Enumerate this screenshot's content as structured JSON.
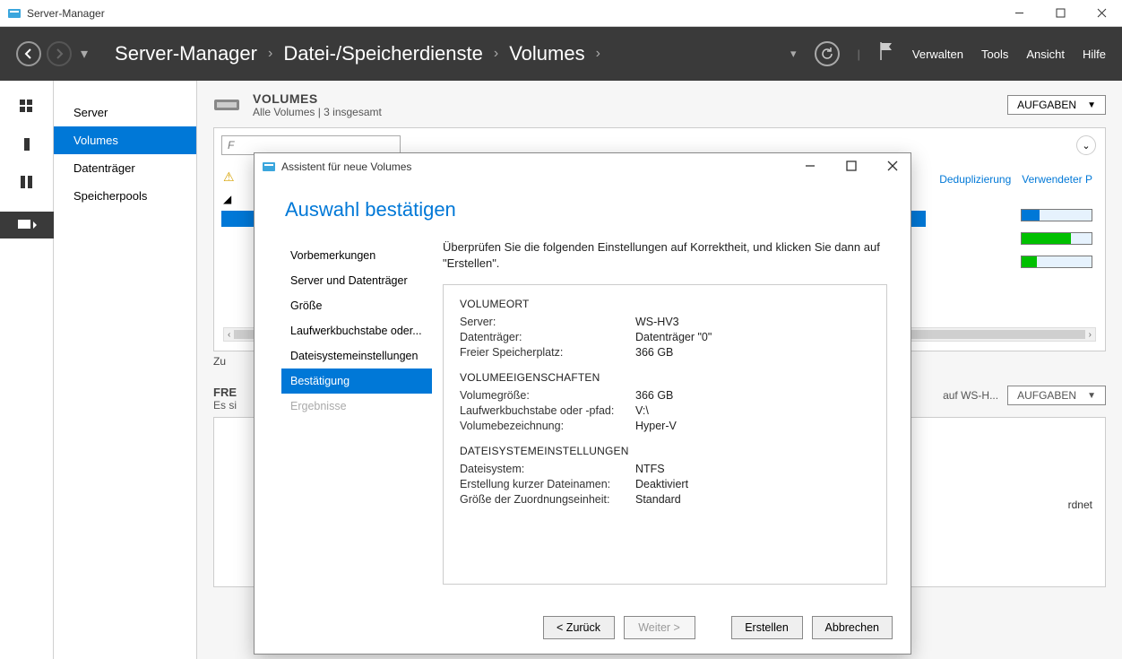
{
  "app": {
    "name": "Server-Manager"
  },
  "header": {
    "breadcrumb": [
      "Server-Manager",
      "Datei-/Speicherdienste",
      "Volumes"
    ],
    "menu": {
      "verwalten": "Verwalten",
      "tools": "Tools",
      "ansicht": "Ansicht",
      "hilfe": "Hilfe"
    }
  },
  "sidebar": {
    "items": [
      {
        "label": "Server"
      },
      {
        "label": "Volumes"
      },
      {
        "label": "Datenträger"
      },
      {
        "label": "Speicherpools"
      }
    ],
    "active_index": 1
  },
  "volumes_section": {
    "title": "VOLUMES",
    "subtitle": "Alle Volumes | 3 insgesamt",
    "aufgaben": "AUFGABEN",
    "filter_placeholder": "F",
    "col_links": [
      "Deduplizierung",
      "Verwendeter P"
    ],
    "footer_text": "Zu"
  },
  "freigaben_section": {
    "title_prefix": "FRE",
    "subtitle_prefix": "Es si",
    "right_frag": "auf WS-H...",
    "aufgaben": "AUFGABEN",
    "panel_text": "rdnet"
  },
  "wizard": {
    "title": "Assistent für neue Volumes",
    "heading": "Auswahl bestätigen",
    "steps": [
      "Vorbemerkungen",
      "Server und Datenträger",
      "Größe",
      "Laufwerkbuchstabe oder...",
      "Dateisystemeinstellungen",
      "Bestätigung",
      "Ergebnisse"
    ],
    "active_step_index": 5,
    "disabled_step_index": 6,
    "instruction": "Überprüfen Sie die folgenden Einstellungen auf Korrektheit, und klicken Sie dann auf \"Erstellen\".",
    "sections": [
      {
        "title": "VOLUMEORT",
        "rows": [
          {
            "label": "Server:",
            "value": "WS-HV3"
          },
          {
            "label": "Datenträger:",
            "value": "Datenträger \"0\""
          },
          {
            "label": "Freier Speicherplatz:",
            "value": "366 GB"
          }
        ]
      },
      {
        "title": "VOLUMEEIGENSCHAFTEN",
        "rows": [
          {
            "label": "Volumegröße:",
            "value": "366 GB"
          },
          {
            "label": "Laufwerkbuchstabe oder -pfad:",
            "value": "V:\\"
          },
          {
            "label": "Volumebezeichnung:",
            "value": "Hyper-V"
          }
        ]
      },
      {
        "title": "DATEISYSTEMEINSTELLUNGEN",
        "rows": [
          {
            "label": "Dateisystem:",
            "value": "NTFS"
          },
          {
            "label": "Erstellung kurzer Dateinamen:",
            "value": "Deaktiviert"
          },
          {
            "label": "Größe der Zuordnungseinheit:",
            "value": "Standard"
          }
        ]
      }
    ],
    "buttons": {
      "back": "< Zurück",
      "next": "Weiter >",
      "create": "Erstellen",
      "cancel": "Abbrechen"
    }
  }
}
